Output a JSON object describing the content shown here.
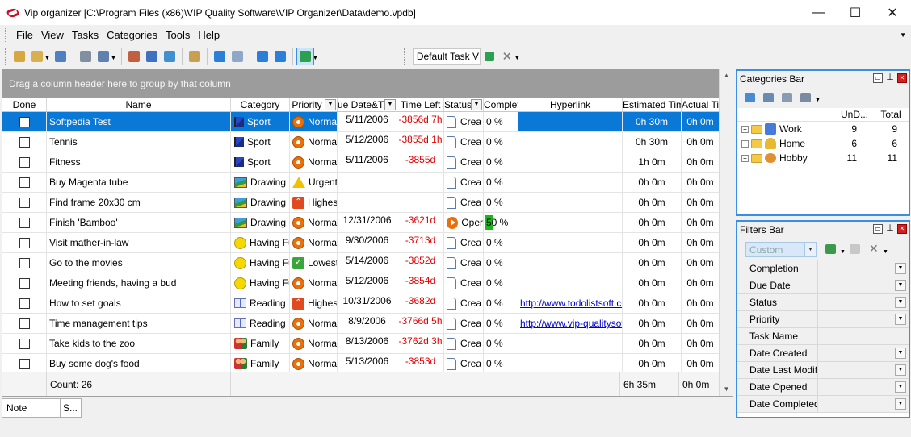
{
  "window": {
    "title": "Vip organizer [C:\\Program Files (x86)\\VIP Quality Software\\VIP Organizer\\Data\\demo.vpdb]",
    "minimize": "—",
    "maximize": "☐",
    "close": "✕"
  },
  "menu": [
    "File",
    "View",
    "Tasks",
    "Categories",
    "Tools",
    "Help"
  ],
  "toolbar": {
    "view_select": "Default Task V",
    "colors": [
      "#d8a840",
      "#d8b050",
      "#5080c0",
      "#8090a0",
      "#6080b0",
      "#c06040",
      "#4070c0",
      "#4090d0",
      "#c8a050",
      "#2a7fd8",
      "#90a8c8",
      "#2a7fd8",
      "#2a7fd8",
      "#2aa050"
    ]
  },
  "grid": {
    "group_hint": "Drag a column header here to group by that column",
    "columns": [
      "Done",
      "Name",
      "Category",
      "Priority",
      "ue Date&Tin",
      "Time Left",
      "Status",
      "Complete",
      "Hyperlink",
      "Estimated Time",
      "Actual Tim"
    ],
    "rows": [
      {
        "name": "Softpedia Test",
        "cat": "Sport",
        "cat_icon": "sport",
        "pri": "Normal",
        "pri_icon": "normal",
        "due": "5/11/2006",
        "left": "-3856d 7h",
        "status": "Crea",
        "status_icon": "doc",
        "pct": "0 %",
        "link": "",
        "est": "0h 30m",
        "act": "0h 0m",
        "sel": true
      },
      {
        "name": "Tennis",
        "cat": "Sport",
        "cat_icon": "sport",
        "pri": "Normal",
        "pri_icon": "normal",
        "due": "5/12/2006",
        "left": "-3855d 1h",
        "status": "Crea",
        "status_icon": "doc",
        "pct": "0 %",
        "link": "",
        "est": "0h 30m",
        "act": "0h 0m"
      },
      {
        "name": "Fitness",
        "cat": "Sport",
        "cat_icon": "sport",
        "pri": "Normal",
        "pri_icon": "normal",
        "due": "5/11/2006",
        "left": "-3855d",
        "status": "Crea",
        "status_icon": "doc",
        "pct": "0 %",
        "link": "",
        "est": "1h 0m",
        "act": "0h 0m"
      },
      {
        "name": "Buy Magenta tube",
        "cat": "Drawing",
        "cat_icon": "drawing",
        "pri": "Urgent",
        "pri_icon": "urgent",
        "due": "",
        "left": "",
        "status": "Crea",
        "status_icon": "doc",
        "pct": "0 %",
        "link": "",
        "est": "0h 0m",
        "act": "0h 0m"
      },
      {
        "name": "Find frame 20x30 cm",
        "cat": "Drawing",
        "cat_icon": "drawing",
        "pri": "Highes",
        "pri_icon": "high",
        "due": "",
        "left": "",
        "status": "Crea",
        "status_icon": "doc",
        "pct": "0 %",
        "link": "",
        "est": "0h 0m",
        "act": "0h 0m"
      },
      {
        "name": "Finish 'Bamboo'",
        "cat": "Drawing",
        "cat_icon": "drawing",
        "pri": "Normal",
        "pri_icon": "normal",
        "due": "12/31/2006",
        "left": "-3621d",
        "status": "Oper",
        "status_icon": "play",
        "pct": "50 %",
        "link": "",
        "est": "0h 0m",
        "act": "0h 0m",
        "bar": true
      },
      {
        "name": "Visit mather-in-law",
        "cat": "Having Fu",
        "cat_icon": "smile",
        "pri": "Normal",
        "pri_icon": "normal",
        "due": "9/30/2006",
        "left": "-3713d",
        "status": "Crea",
        "status_icon": "doc",
        "pct": "0 %",
        "link": "",
        "est": "0h 0m",
        "act": "0h 0m"
      },
      {
        "name": "Go to the movies",
        "cat": "Having Fu",
        "cat_icon": "smile",
        "pri": "Lowest",
        "pri_icon": "low",
        "due": "5/14/2006",
        "left": "-3852d",
        "status": "Crea",
        "status_icon": "doc",
        "pct": "0 %",
        "link": "",
        "est": "0h 0m",
        "act": "0h 0m"
      },
      {
        "name": "Meeting friends, having a bud",
        "cat": "Having Fu",
        "cat_icon": "smile",
        "pri": "Normal",
        "pri_icon": "normal",
        "due": "5/12/2006",
        "left": "-3854d",
        "status": "Crea",
        "status_icon": "doc",
        "pct": "0 %",
        "link": "",
        "est": "0h 0m",
        "act": "0h 0m"
      },
      {
        "name": "How to set goals",
        "cat": "Reading",
        "cat_icon": "book",
        "pri": "Highes",
        "pri_icon": "high",
        "due": "10/31/2006",
        "left": "-3682d",
        "status": "Crea",
        "status_icon": "doc",
        "pct": "0 %",
        "link": "http://www.todolistsoft.co",
        "est": "0h 0m",
        "act": "0h 0m"
      },
      {
        "name": "Time management tips",
        "cat": "Reading",
        "cat_icon": "book",
        "pri": "Normal",
        "pri_icon": "normal",
        "due": "8/9/2006",
        "left": "-3766d 5h",
        "status": "Crea",
        "status_icon": "doc",
        "pct": "0 %",
        "link": "http://www.vip-qualitysof",
        "est": "0h 0m",
        "act": "0h 0m"
      },
      {
        "name": "Take kids to the zoo",
        "cat": "Family",
        "cat_icon": "family",
        "pri": "Normal",
        "pri_icon": "normal",
        "due": "8/13/2006",
        "left": "-3762d 3h",
        "status": "Crea",
        "status_icon": "doc",
        "pct": "0 %",
        "link": "",
        "est": "0h 0m",
        "act": "0h 0m"
      },
      {
        "name": "Buy some dog's food",
        "cat": "Family",
        "cat_icon": "family",
        "pri": "Normal",
        "pri_icon": "normal",
        "due": "5/13/2006",
        "left": "-3853d",
        "status": "Crea",
        "status_icon": "doc",
        "pct": "0 %",
        "link": "",
        "est": "0h 0m",
        "act": "0h 0m"
      }
    ],
    "footer": {
      "count": "Count: 26",
      "est_total": "6h 35m",
      "act_total": "0h 0m"
    }
  },
  "notebar": {
    "tabs": [
      "Note",
      "S..."
    ]
  },
  "categories_bar": {
    "title": "Categories Bar",
    "columns": [
      "UnD...",
      "Total"
    ],
    "items": [
      {
        "name": "Work",
        "undone": "9",
        "total": "9"
      },
      {
        "name": "Home",
        "undone": "6",
        "total": "6"
      },
      {
        "name": "Hobby",
        "undone": "11",
        "total": "11"
      }
    ]
  },
  "filters_bar": {
    "title": "Filters Bar",
    "combo": "Custom",
    "items": [
      "Completion",
      "Due Date",
      "Status",
      "Priority",
      "Task Name",
      "Date Created",
      "Date Last Modifie",
      "Date Opened",
      "Date Completed"
    ],
    "has_dropdown": [
      true,
      true,
      true,
      true,
      false,
      true,
      true,
      true,
      true
    ]
  }
}
